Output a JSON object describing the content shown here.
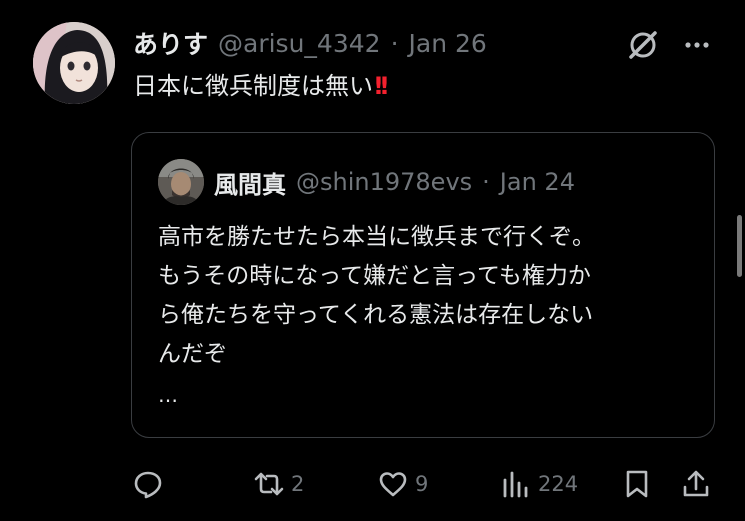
{
  "post": {
    "display_name": "ありす",
    "handle": "@arisu_4342",
    "separator": "·",
    "date": "Jan 26",
    "text": "日本に徴兵制度は無い",
    "emoji": "!!"
  },
  "quoted_post": {
    "display_name": "風間真",
    "handle": "@shin1978evs",
    "separator": "·",
    "date": "Jan 24",
    "lines": [
      "高市を勝たせたら本当に徴兵まで行くぞ。",
      "もうその時になって嫌だと言っても権力か",
      "ら俺たちを守ってくれる憲法は存在しない",
      "んだぞ"
    ],
    "ellipsis": "…"
  },
  "actions": {
    "reposts": "2",
    "likes": "9",
    "views": "224"
  },
  "colors": {
    "background": "#000000",
    "text": "#e7e9ea",
    "muted": "#71767b",
    "border": "#3a3d41",
    "emoji_red": "#f4212e"
  },
  "icons": [
    "grok-icon",
    "more-icon",
    "reply-icon",
    "repost-icon",
    "like-icon",
    "views-icon",
    "bookmark-icon",
    "share-icon"
  ]
}
